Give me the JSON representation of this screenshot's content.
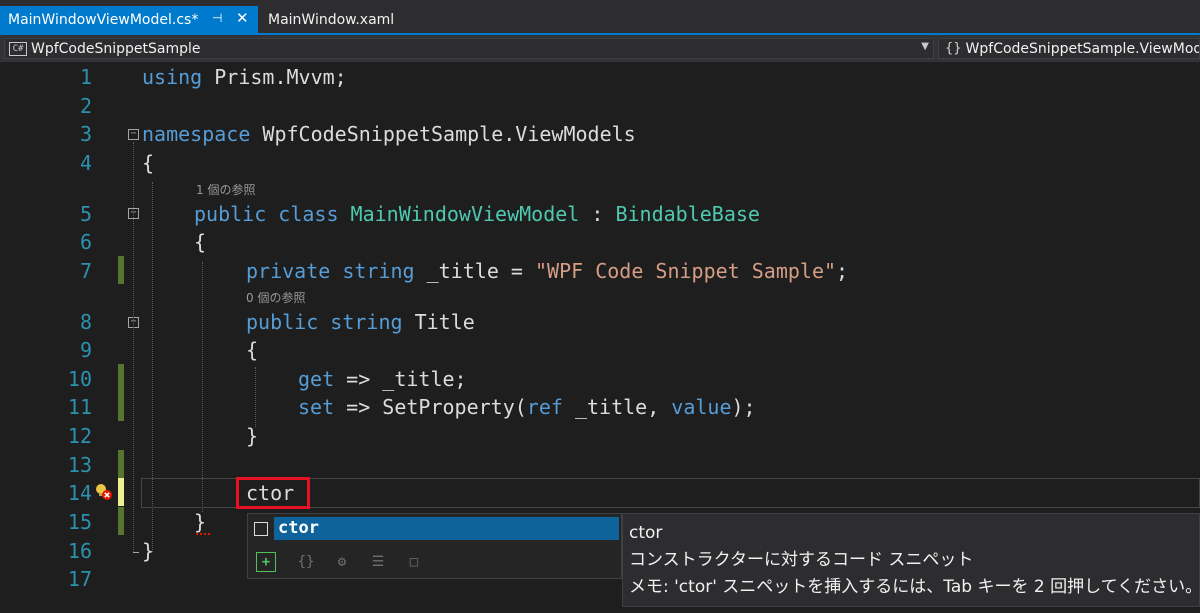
{
  "tabs": [
    {
      "label": "MainWindowViewModel.cs*",
      "active": true
    },
    {
      "label": "MainWindow.xaml",
      "active": false
    }
  ],
  "tab_icons": {
    "pin": "pin-icon",
    "close": "close-icon"
  },
  "navbar": {
    "project_icon": "C#",
    "project": "WpfCodeSnippetSample",
    "scope": "WpfCodeSnippetSample.ViewModels"
  },
  "line_numbers": [
    "1",
    "2",
    "3",
    "4",
    "5",
    "6",
    "7",
    "8",
    "9",
    "10",
    "11",
    "12",
    "13",
    "14",
    "15",
    "16",
    "17"
  ],
  "code": {
    "l1_kw": "using",
    "l1_rest": " Prism.Mvvm;",
    "l3_kw": "namespace",
    "l3_rest": " WpfCodeSnippetSample.ViewModels",
    "l4": "{",
    "lens1": "1 個の参照",
    "l5_kw": "public class",
    "l5_class": " MainWindowViewModel",
    "l5_colon": " : ",
    "l5_base": "BindableBase",
    "l6": "{",
    "l7_kw": "private string",
    "l7_mid": " _title = ",
    "l7_str": "\"WPF Code Snippet Sample\"",
    "l7_end": ";",
    "lens2": "0 個の参照",
    "l8_kw": "public string",
    "l8_rest": " Title",
    "l9": "{",
    "l10_kw": "get",
    "l10_rest": " => _title;",
    "l11_kw": "set",
    "l11_mid": " => SetProperty(",
    "l11_ref": "ref",
    "l11_mid2": " _title, ",
    "l11_value": "value",
    "l11_end": ");",
    "l12": "}",
    "l14": "ctor",
    "l15": "}",
    "l16": "}"
  },
  "completion": {
    "item": "ctor",
    "filters": [
      "+",
      "{}",
      "⚙",
      "☰",
      "□"
    ]
  },
  "tooltip": {
    "title": "ctor",
    "description": "コンストラクターに対するコード スニペット",
    "note": "メモ: 'ctor' スニペットを挿入するには、Tab キーを 2 回押してください。"
  },
  "colors": {
    "accent": "#007acc",
    "keyword": "#569cd6",
    "type": "#4ec9b0",
    "string": "#d69d85",
    "line_number": "#2b91af",
    "highlight_box": "#e81123",
    "changed_margin": "#577430"
  }
}
